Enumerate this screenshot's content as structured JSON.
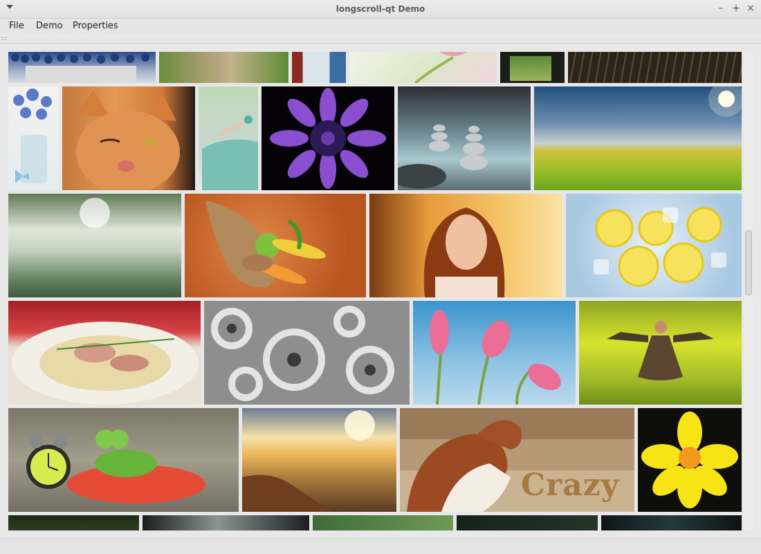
{
  "window": {
    "title": "longscroll-qt Demo"
  },
  "menu": {
    "items": [
      "File",
      "Demo",
      "Properties"
    ]
  },
  "photos": {
    "row0": [
      "blueberry bowl",
      "dirt road through grass",
      "butterfly window",
      "pink tulip close-up",
      "window view",
      "piano keys"
    ],
    "row1": [
      "forget-me-not flowers in jar",
      "winking ginger cat",
      "legs in teal car",
      "purple gerbera flower",
      "stone cairns by river",
      "green field with sun"
    ],
    "row2": [
      "frosted grass at sunrise",
      "cornucopia with vegetables",
      "woman with red hair",
      "lemon slices on ice"
    ],
    "row3": [
      "pasta with mushrooms",
      "metal gears",
      "pink tulips on blue",
      "woman in yellow flower field"
    ],
    "row4": [
      "frog figurine with alarm clock",
      "misty sunrise landscape",
      "horses \"Crazy\"",
      "yellow daffodil"
    ],
    "row5": [
      "dark forest",
      "waterfall",
      "green meadow",
      "dark landscape",
      "dark portrait"
    ],
    "crazy_text": "Crazy"
  }
}
